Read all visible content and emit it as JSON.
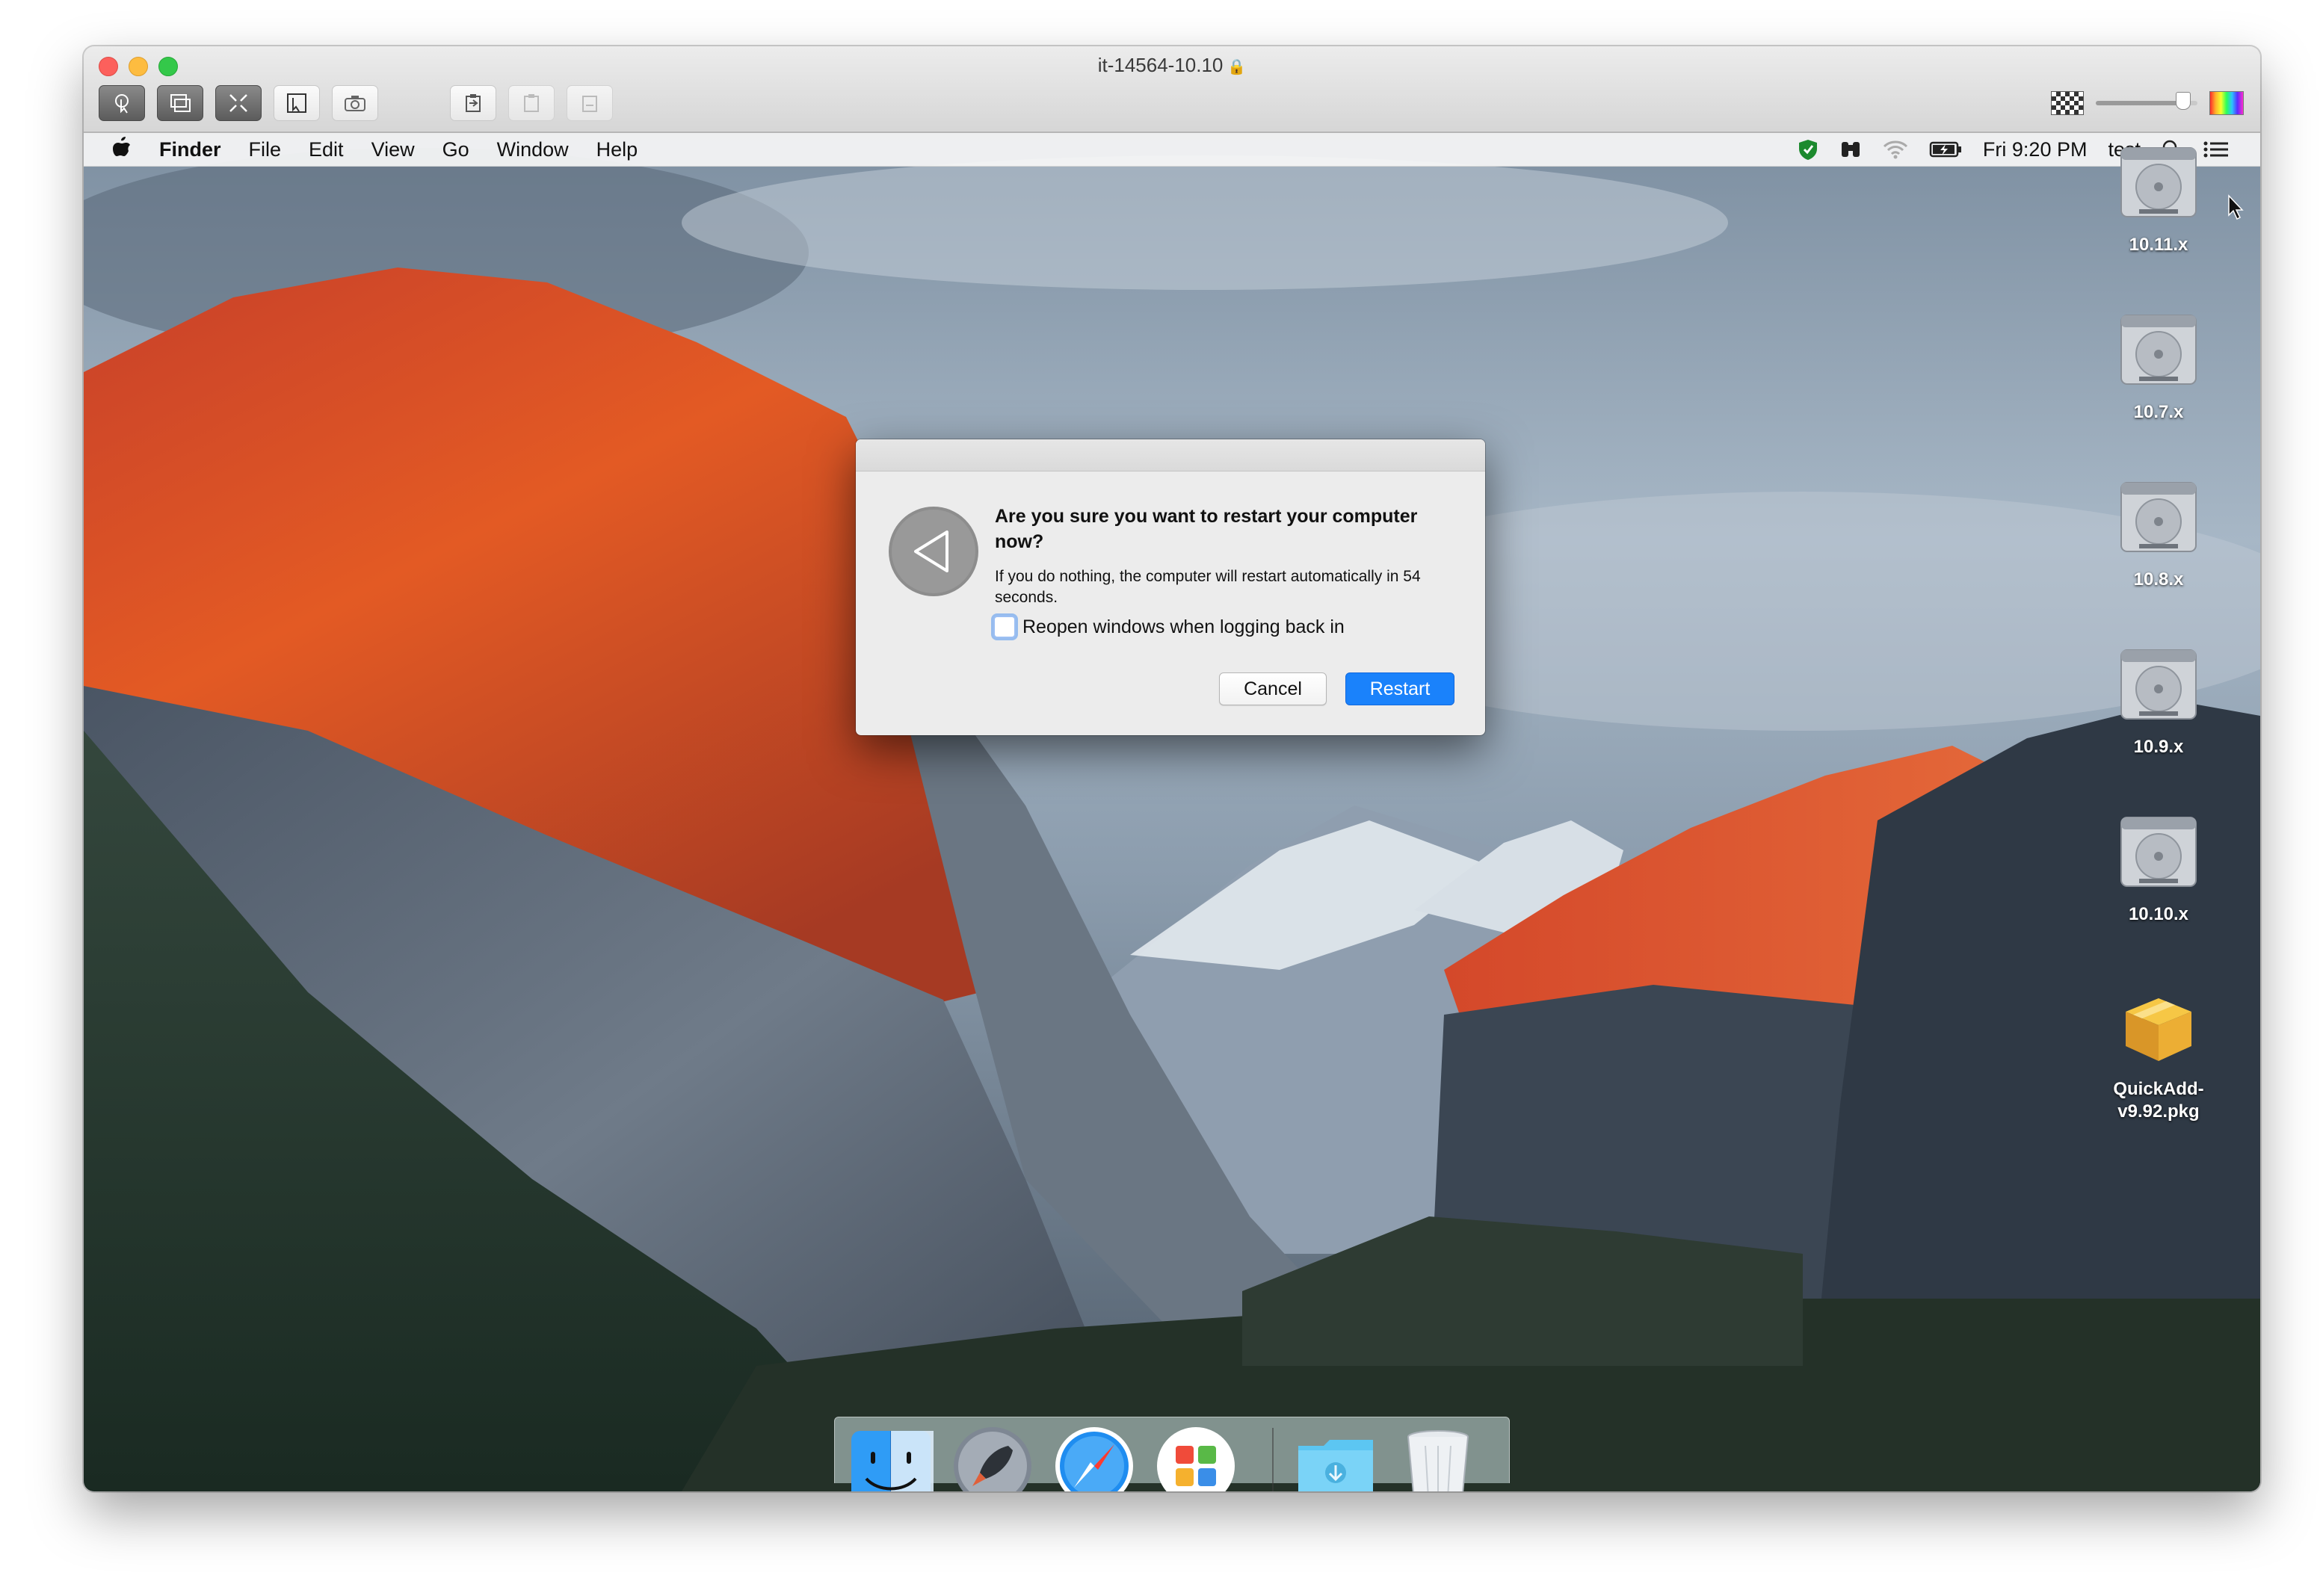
{
  "window": {
    "title": "it-14564-10.10",
    "lock_icon": "lock-icon"
  },
  "toolbar": {
    "buttons": [
      "pointer-icon",
      "window-icon",
      "fullscreen-icon",
      "select-icon",
      "camera-icon",
      "clipboard-icon",
      "paste-icon",
      "paste-alt-icon"
    ],
    "right_tools": [
      "checkerboard-icon",
      "zoom-slider",
      "color-picker-icon"
    ],
    "zoom_level": 0.85
  },
  "menubar": {
    "apple_icon": "apple-icon",
    "app_name": "Finder",
    "menus": [
      "File",
      "Edit",
      "View",
      "Go",
      "Window",
      "Help"
    ],
    "clock": "Fri 9:20 PM",
    "user": "test",
    "status_icons": [
      "shield-icon",
      "binoculars-icon",
      "wifi-icon",
      "battery-icon",
      "spotlight-icon",
      "notification-center-icon"
    ]
  },
  "desktop": {
    "icons": [
      {
        "label": "10.11.x",
        "type": "disk"
      },
      {
        "label": "10.7.x",
        "type": "disk"
      },
      {
        "label": "10.8.x",
        "type": "disk"
      },
      {
        "label": "10.9.x",
        "type": "disk"
      },
      {
        "label": "10.10.x",
        "type": "disk"
      },
      {
        "label": "QuickAdd-v9.92.pkg",
        "type": "package"
      }
    ]
  },
  "dialog": {
    "title": "Are you sure you want to restart your computer now?",
    "message": "If you do nothing, the computer will restart automatically in 54 seconds.",
    "checkbox_label": "Reopen windows when logging back in",
    "checkbox_checked": false,
    "cancel_label": "Cancel",
    "restart_label": "Restart",
    "accent_color": "#1a82fb"
  },
  "dock": {
    "apps": [
      "finder-icon",
      "launchpad-icon",
      "safari-icon",
      "self-service-icon"
    ],
    "others": [
      "downloads-folder-icon",
      "trash-icon"
    ],
    "running": [
      "finder-icon"
    ]
  }
}
